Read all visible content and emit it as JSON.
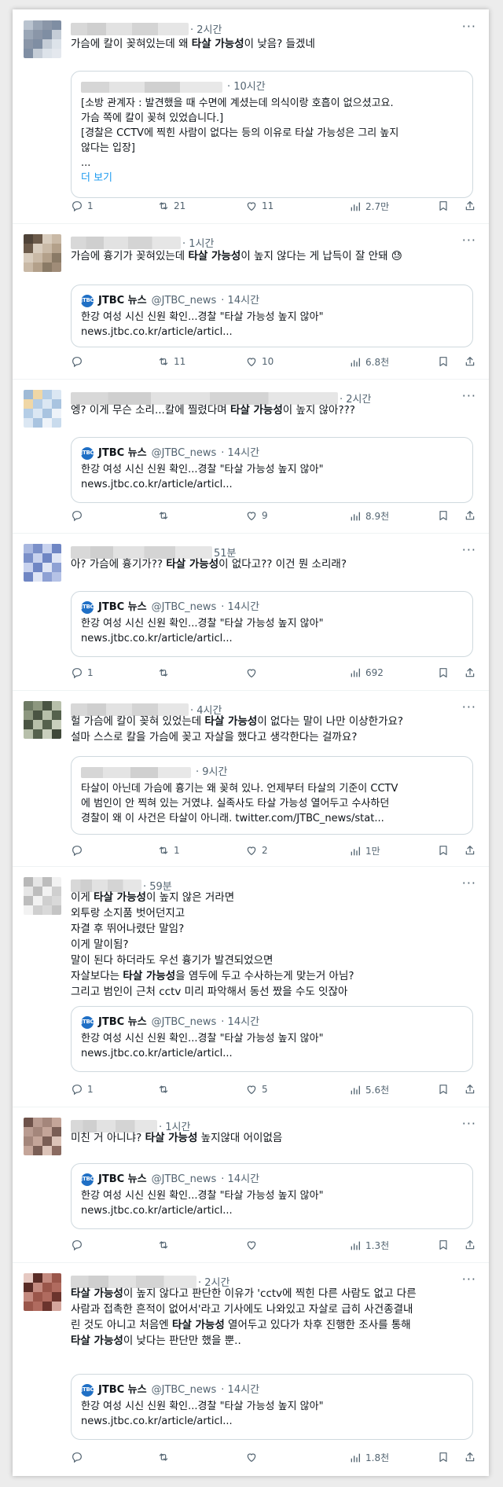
{
  "tweets": [
    {
      "time": "· 2시간",
      "lines": [
        [
          [
            "가슴에 칼이 꽂혀있는데 왜 ",
            0
          ],
          [
            "타살 가능성",
            1
          ],
          [
            "이 낮음? 들겠네",
            0
          ]
        ]
      ],
      "quote": {
        "kind": "user",
        "time": "· 10시간",
        "lines": [
          "[소방 관계자 : 발견했을 때 수면에 계셨는데 의식이랑 호흡이 없으셨고요.",
          "가슴 쪽에 칼이 꽂혀 있었습니다.]",
          "[경찰은 CCTV에 찍힌 사람이 없다는 등의 이유로 타살 가능성은 그리 높지",
          "않다는 입장]",
          "...",
          "더 보기"
        ]
      },
      "stats": {
        "reply": "1",
        "retweet": "21",
        "like": "11",
        "views": "2.7만"
      }
    },
    {
      "time": "· 1시간",
      "lines": [
        [
          [
            "가슴에 흉기가 꽂혀있는데 ",
            0
          ],
          [
            "타살 가능성",
            1
          ],
          [
            "이 높지 않다는 게 납득이 잘 안돼 😓",
            0
          ]
        ]
      ],
      "quote": {
        "kind": "news"
      },
      "stats": {
        "reply": "",
        "retweet": "11",
        "like": "10",
        "views": "6.8천"
      }
    },
    {
      "time": "· 2시간",
      "lines": [
        [
          [
            "엥? 이게 무슨 소리...칼에 찔렸다며 ",
            0
          ],
          [
            "타살 가능성",
            1
          ],
          [
            "이 높지 않아???",
            0
          ]
        ]
      ],
      "quote": {
        "kind": "news"
      },
      "stats": {
        "reply": "",
        "retweet": "",
        "like": "9",
        "views": "8.9천"
      }
    },
    {
      "time": "51분",
      "lines": [
        [
          [
            "아? 가슴에 흉기가?? ",
            0
          ],
          [
            "타살 가능성",
            1
          ],
          [
            "이 없다고?? 이건 뭔 소리래?",
            0
          ]
        ]
      ],
      "quote": {
        "kind": "news"
      },
      "stats": {
        "reply": "1",
        "retweet": "",
        "like": "",
        "views": "692"
      }
    },
    {
      "time": "· 4시간",
      "lines": [
        [
          [
            "헐 가슴에 칼이 꽂혀 있었는데 ",
            0
          ],
          [
            "타살 가능성",
            1
          ],
          [
            "이 없다는 말이 나만 이상한가요?",
            0
          ]
        ],
        [
          [
            "설마 스스로 칼을 가슴에 꽂고 자살을 했다고 생각한다는 걸까요?",
            0
          ]
        ]
      ],
      "quote": {
        "kind": "user",
        "time": "· 9시간",
        "lines": [
          "타살이 아닌데 가슴에 흉기는 왜 꽂혀 있나. 언제부터 타살의 기준이 CCTV",
          "에 범인이 안 찍혀 있는 거였냐. 실족사도 타살 가능성 열어두고 수사하던",
          "경찰이 왜 이 사건은 타살이 아니래. twitter.com/JTBC_news/stat..."
        ]
      },
      "stats": {
        "reply": "",
        "retweet": "1",
        "like": "2",
        "views": "1만"
      }
    },
    {
      "time": "· 59분",
      "lines": [
        [
          [
            "이게 ",
            0
          ],
          [
            "타살 가능성",
            1
          ],
          [
            "이 높지 않은 거라면",
            0
          ]
        ],
        [
          [
            "외투랑 소지품 벗어던지고",
            0
          ]
        ],
        [
          [
            "자결 후 뛰어나렸단 말임?",
            0
          ]
        ],
        [
          [
            "이게 말이됨?",
            0
          ]
        ],
        [
          [
            "말이 된다 하더라도 우선 흉기가 발견되었으면",
            0
          ]
        ],
        [
          [
            "자살보다는 ",
            0
          ],
          [
            "타살 가능성",
            1
          ],
          [
            "을 염두에 두고 수사하는게 맞는거 아님?",
            0
          ]
        ],
        [
          [
            "그리고 범인이 근처 cctv 미리 파악해서 동선 짰을 수도 잇잖아",
            0
          ]
        ]
      ],
      "quote": {
        "kind": "news"
      },
      "stats": {
        "reply": "1",
        "retweet": "",
        "like": "5",
        "views": "5.6천"
      }
    },
    {
      "time": "· 1시간",
      "lines": [
        [
          [
            "미친 거 아니냐? ",
            0
          ],
          [
            "타살 가능성",
            1
          ],
          [
            " 높지않대 어이없음",
            0
          ]
        ]
      ],
      "quote": {
        "kind": "news"
      },
      "stats": {
        "reply": "",
        "retweet": "",
        "like": "",
        "views": "1.3천"
      }
    },
    {
      "time": "· 2시간",
      "lines": [
        [
          [
            "타살 가능성",
            1
          ],
          [
            "이 높지 않다고 판단한 이유가 'cctv에 찍힌 다른 사람도 없고 다른",
            0
          ]
        ],
        [
          [
            "사람과 접촉한 흔적이 없어서'라고 기사에도 나와있고 자살로 급히 사건종결내",
            0
          ]
        ],
        [
          [
            "린 것도 아니고 처음엔 ",
            0
          ],
          [
            "타살 가능성",
            1
          ],
          [
            " 열어두고 있다가 차후 진행한 조사를 통해",
            0
          ]
        ],
        [
          [
            "타살 가능성",
            1
          ],
          [
            "이 낮다는 판단만 했을 뿐..",
            0
          ]
        ]
      ],
      "quote": {
        "kind": "news"
      },
      "stats": {
        "reply": "",
        "retweet": "",
        "like": "",
        "views": "1.8천"
      }
    }
  ],
  "news_card": {
    "logo": "JTBC",
    "brand": "JTBC 뉴스",
    "handle": "@JTBC_news",
    "time": "· 14시간",
    "headline": "한강 여성 시신 신원 확인...경찰 \"타살 가능성 높지 않아\"",
    "url": "news.jtbc.co.kr/article/articl..."
  },
  "icons": {
    "reply": "reply-icon",
    "retweet": "retweet-icon",
    "like": "heart-icon",
    "views": "views-icon",
    "save": "bookmark-icon",
    "share": "share-icon",
    "more": "more-icon"
  }
}
